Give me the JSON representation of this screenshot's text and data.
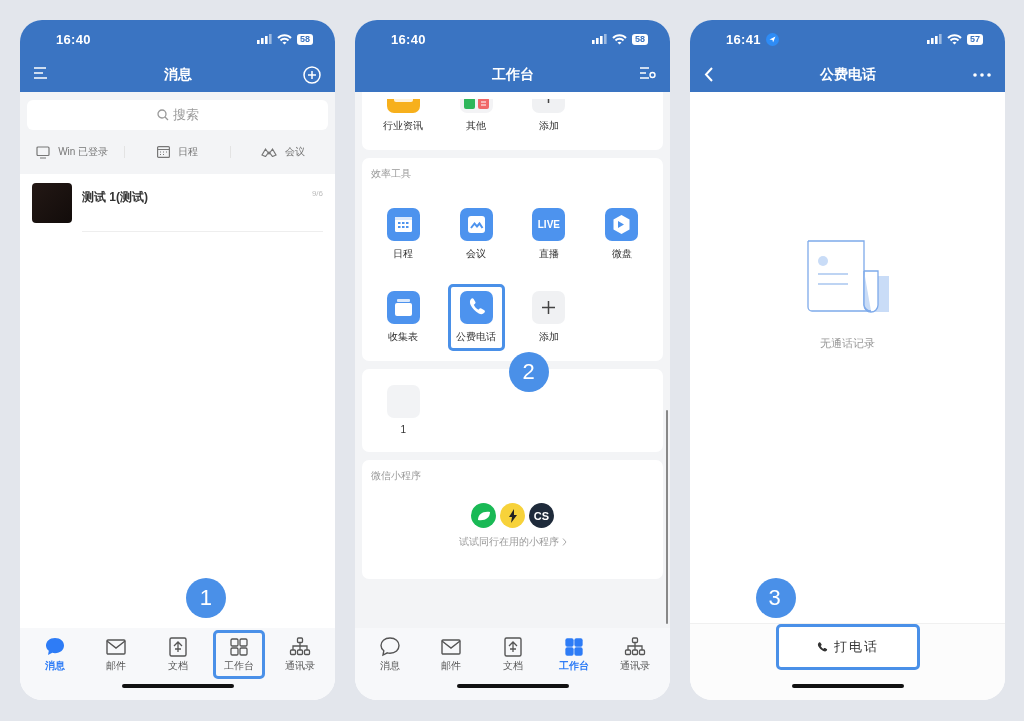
{
  "screens": [
    {
      "kind": "messages",
      "time": "16:40",
      "battery": "58",
      "location": false,
      "title": "消息",
      "step": "1",
      "search": {
        "placeholder": "搜索"
      },
      "shortcuts": [
        {
          "label": "Win 已登录"
        },
        {
          "label": "日程"
        },
        {
          "label": "会议"
        }
      ],
      "chats": [
        {
          "name": "测试 1(测试)",
          "date": "9/6"
        }
      ],
      "tabs": [
        {
          "label": "消息",
          "selected": true,
          "highlighted": false
        },
        {
          "label": "邮件",
          "selected": false,
          "highlighted": false
        },
        {
          "label": "文档",
          "selected": false,
          "highlighted": false
        },
        {
          "label": "工作台",
          "selected": false,
          "highlighted": true
        },
        {
          "label": "通讯录",
          "selected": false,
          "highlighted": false
        }
      ]
    },
    {
      "kind": "workbench",
      "time": "16:40",
      "battery": "58",
      "location": false,
      "title": "工作台",
      "step": "2",
      "sections": [
        {
          "apps": [
            {
              "label": "行业资讯",
              "highlighted": false
            },
            {
              "label": "其他",
              "highlighted": false
            },
            {
              "label": "添加",
              "highlighted": false
            }
          ]
        },
        {
          "title": "效率工具",
          "apps": [
            {
              "label": "日程",
              "highlighted": false
            },
            {
              "label": "会议",
              "highlighted": false
            },
            {
              "label": "直播",
              "icon_text": "LIVE",
              "highlighted": false
            },
            {
              "label": "微盘",
              "highlighted": false
            },
            {
              "label": "收集表",
              "highlighted": false
            },
            {
              "label": "公费电话",
              "highlighted": true
            },
            {
              "label": "添加",
              "highlighted": false
            }
          ]
        },
        {
          "apps": [
            {
              "label": "1",
              "highlighted": false
            }
          ]
        },
        {
          "title": "微信小程序",
          "mini_programs": [
            {
              "color": "#19b955"
            },
            {
              "color": "#f7d23a"
            },
            {
              "text": "CS",
              "color": "#1e2a3a"
            }
          ],
          "hint": "试试同行在用的小程序"
        }
      ],
      "tabs": [
        {
          "label": "消息",
          "selected": false,
          "highlighted": false
        },
        {
          "label": "邮件",
          "selected": false,
          "highlighted": false
        },
        {
          "label": "文档",
          "selected": false,
          "highlighted": false
        },
        {
          "label": "工作台",
          "selected": true,
          "highlighted": false
        },
        {
          "label": "通讯录",
          "selected": false,
          "highlighted": false
        }
      ]
    },
    {
      "kind": "call",
      "time": "16:41",
      "battery": "57",
      "location": true,
      "title": "公费电话",
      "step": "3",
      "empty": "无通话记录",
      "action": {
        "label": "打电话",
        "highlighted": true
      }
    }
  ]
}
